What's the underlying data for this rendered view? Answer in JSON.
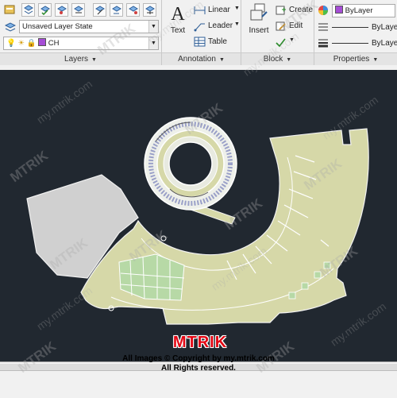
{
  "ribbon": {
    "layers": {
      "title": "Layers",
      "layer_state": "Unsaved Layer State",
      "current_layer": "CH",
      "current_layer_color": "#a64dd6"
    },
    "annotation": {
      "title": "Annotation",
      "text_label": "Text",
      "linear_label": "Linear",
      "leader_label": "Leader",
      "table_label": "Table"
    },
    "block": {
      "title": "Block",
      "insert_label": "Insert",
      "create_label": "Create",
      "edit_label": "Edit"
    },
    "properties": {
      "title": "Properties",
      "color_value": "ByLayer",
      "color_swatch": "#a64dd6",
      "linetype_value": "ByLayer",
      "lineweight_value": "ByLayer"
    }
  },
  "canvas": {
    "background": "#212830",
    "floor_fill": "#d6d8a8",
    "green_fill": "#b7d9a6",
    "grey_fill": "#d0d0d0"
  },
  "watermark": {
    "brand": "MTRIK",
    "url": "my.mtrik.com"
  },
  "footer": {
    "logo": "MTRIK",
    "copyright_line1": "All Images © Copyright by my.mtrik.com",
    "copyright_line2": "All Rights reserved."
  }
}
